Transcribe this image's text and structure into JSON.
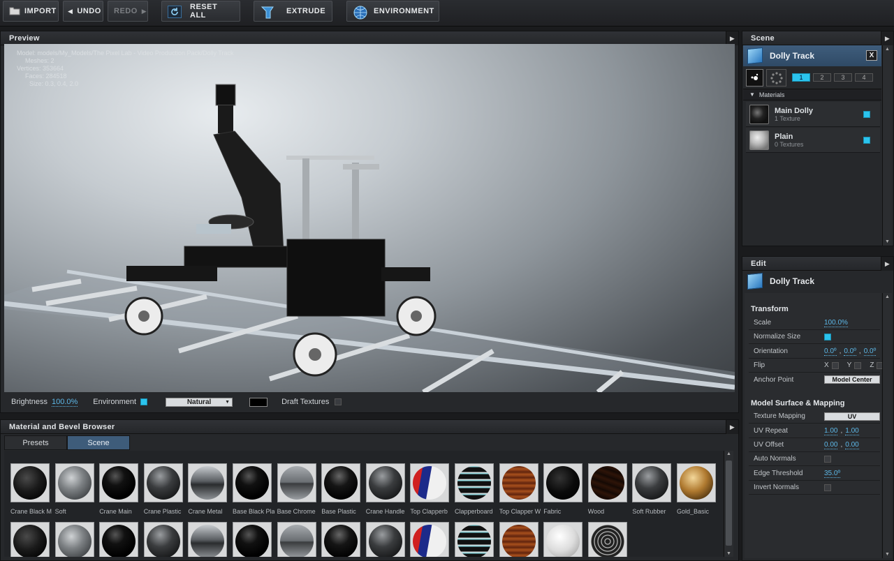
{
  "toolbar": {
    "import": "IMPORT",
    "undo": "UNDO",
    "redo": "REDO",
    "reset_all": "RESET ALL",
    "extrude": "EXTRUDE",
    "environment": "ENVIRONMENT"
  },
  "preview": {
    "title": "Preview",
    "info": {
      "model": "Model: models/My_Models/The Pixel Lab - Video Production Pack/Dolly Track",
      "meshes": "Meshes: 2",
      "vertices": "Vertices: 353664",
      "faces": "Faces: 284518",
      "size": "Size: 0.3, 0.4, 2.0"
    },
    "brightness_label": "Brightness",
    "brightness_value": "100.0%",
    "environment_label": "Environment",
    "environment_checked": true,
    "env_preset": "Natural",
    "draft_label": "Draft Textures",
    "draft_checked": false
  },
  "browser": {
    "title": "Material and Bevel Browser",
    "tabs": [
      "Presets",
      "Scene"
    ],
    "active_tab": "Scene",
    "materials_row1": [
      {
        "name": "Crane Black M",
        "style": "black"
      },
      {
        "name": "Soft",
        "style": "grey"
      },
      {
        "name": "Crane Main",
        "style": "gloss"
      },
      {
        "name": "Crane Plastic",
        "style": "darkgrey"
      },
      {
        "name": "Crane Metal",
        "style": "chrome"
      },
      {
        "name": "Base Black Pla",
        "style": "gloss"
      },
      {
        "name": "Base Chrome",
        "style": "chrome2"
      },
      {
        "name": "Base Plastic",
        "style": "gloss2"
      },
      {
        "name": "Crane Handle",
        "style": "darkgrey"
      },
      {
        "name": "Top Clapperb",
        "style": "clapper"
      },
      {
        "name": "Clapperboard",
        "style": "clapboard"
      },
      {
        "name": "Top Clapper W",
        "style": "wood"
      },
      {
        "name": "Fabric",
        "style": "fabric"
      },
      {
        "name": "Wood",
        "style": "darkwood"
      },
      {
        "name": "Soft Rubber",
        "style": "darkgrey"
      },
      {
        "name": "Gold_Basic",
        "style": "gold"
      }
    ],
    "materials_row2": [
      {
        "style": "black"
      },
      {
        "style": "grey"
      },
      {
        "style": "gloss"
      },
      {
        "style": "darkgrey"
      },
      {
        "style": "chrome"
      },
      {
        "style": "gloss"
      },
      {
        "style": "chrome2"
      },
      {
        "style": "gloss2"
      },
      {
        "style": "darkgrey"
      },
      {
        "style": "clapper"
      },
      {
        "style": "clapboard"
      },
      {
        "style": "wood"
      },
      {
        "style": "white"
      },
      {
        "style": "pattern"
      }
    ]
  },
  "scene": {
    "title": "Scene",
    "selected": "Dolly Track",
    "close": "X",
    "pages": [
      "1",
      "2",
      "3",
      "4"
    ],
    "active_page": "1",
    "materials_header": "Materials",
    "materials": [
      {
        "name": "Main Dolly",
        "sub": "1 Texture",
        "checked": true
      },
      {
        "name": "Plain",
        "sub": "0 Textures",
        "checked": true
      }
    ]
  },
  "edit": {
    "title": "Edit",
    "selected": "Dolly Track",
    "transform": {
      "heading": "Transform",
      "scale_label": "Scale",
      "scale_value": "100.0%",
      "normalize_label": "Normalize Size",
      "orientation_label": "Orientation",
      "orientation_x": "0.0º",
      "orientation_y": "0.0º",
      "orientation_z": "0.0º",
      "flip_label": "Flip",
      "flip_x": "X",
      "flip_y": "Y",
      "flip_z": "Z",
      "anchor_label": "Anchor Point",
      "anchor_value": "Model Center"
    },
    "surface": {
      "heading": "Model Surface & Mapping",
      "mapping_label": "Texture Mapping",
      "mapping_value": "UV",
      "repeat_label": "UV Repeat",
      "repeat_u": "1.00",
      "repeat_v": "1.00",
      "offset_label": "UV Offset",
      "offset_u": "0.00",
      "offset_v": "0.00",
      "auto_normals_label": "Auto Normals",
      "edge_label": "Edge Threshold",
      "edge_value": "35.0º",
      "invert_label": "Invert Normals"
    }
  },
  "colors": {
    "accent": "#2bc4ee",
    "link": "#5db8e8",
    "selection": "#3f5d7c"
  }
}
